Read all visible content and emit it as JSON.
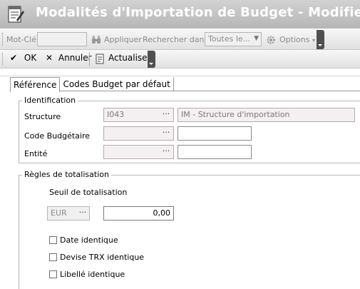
{
  "window": {
    "title": "Modalités d'Importation de Budget - Modifier"
  },
  "toolbar1": {
    "keyword_label": "Mot-Clé",
    "keyword_value": "",
    "apply_label": "Appliquer",
    "search_in_label": "Rechercher dans",
    "search_in_value": "Toutes le...",
    "options_label": "Options"
  },
  "toolbar2": {
    "ok_label": "OK",
    "cancel_label": "Annuler",
    "refresh_label": "Actualiser"
  },
  "tabs": [
    {
      "label": "Référence",
      "active": true
    },
    {
      "label": "Codes Budget par défaut",
      "active": false
    }
  ],
  "identification": {
    "legend": "Identification",
    "structure_label": "Structure",
    "structure_code": "I043",
    "structure_desc": "IM - Structure d'importation",
    "budget_code_label": "Code Budgétaire",
    "budget_code_value": "",
    "budget_code_desc": "",
    "entity_label": "Entité",
    "entity_value": "",
    "entity_desc": ""
  },
  "totals": {
    "legend": "Règles de totalisation",
    "threshold_label": "Seuil de totalisation",
    "currency": "EUR",
    "threshold_value": "0,00",
    "checkboxes": [
      {
        "label": "Date identique",
        "checked": false
      },
      {
        "label": "Devise TRX identique",
        "checked": false
      },
      {
        "label": "Libellé identique",
        "checked": false
      }
    ]
  },
  "buttons": {
    "ellipsis": "···"
  }
}
